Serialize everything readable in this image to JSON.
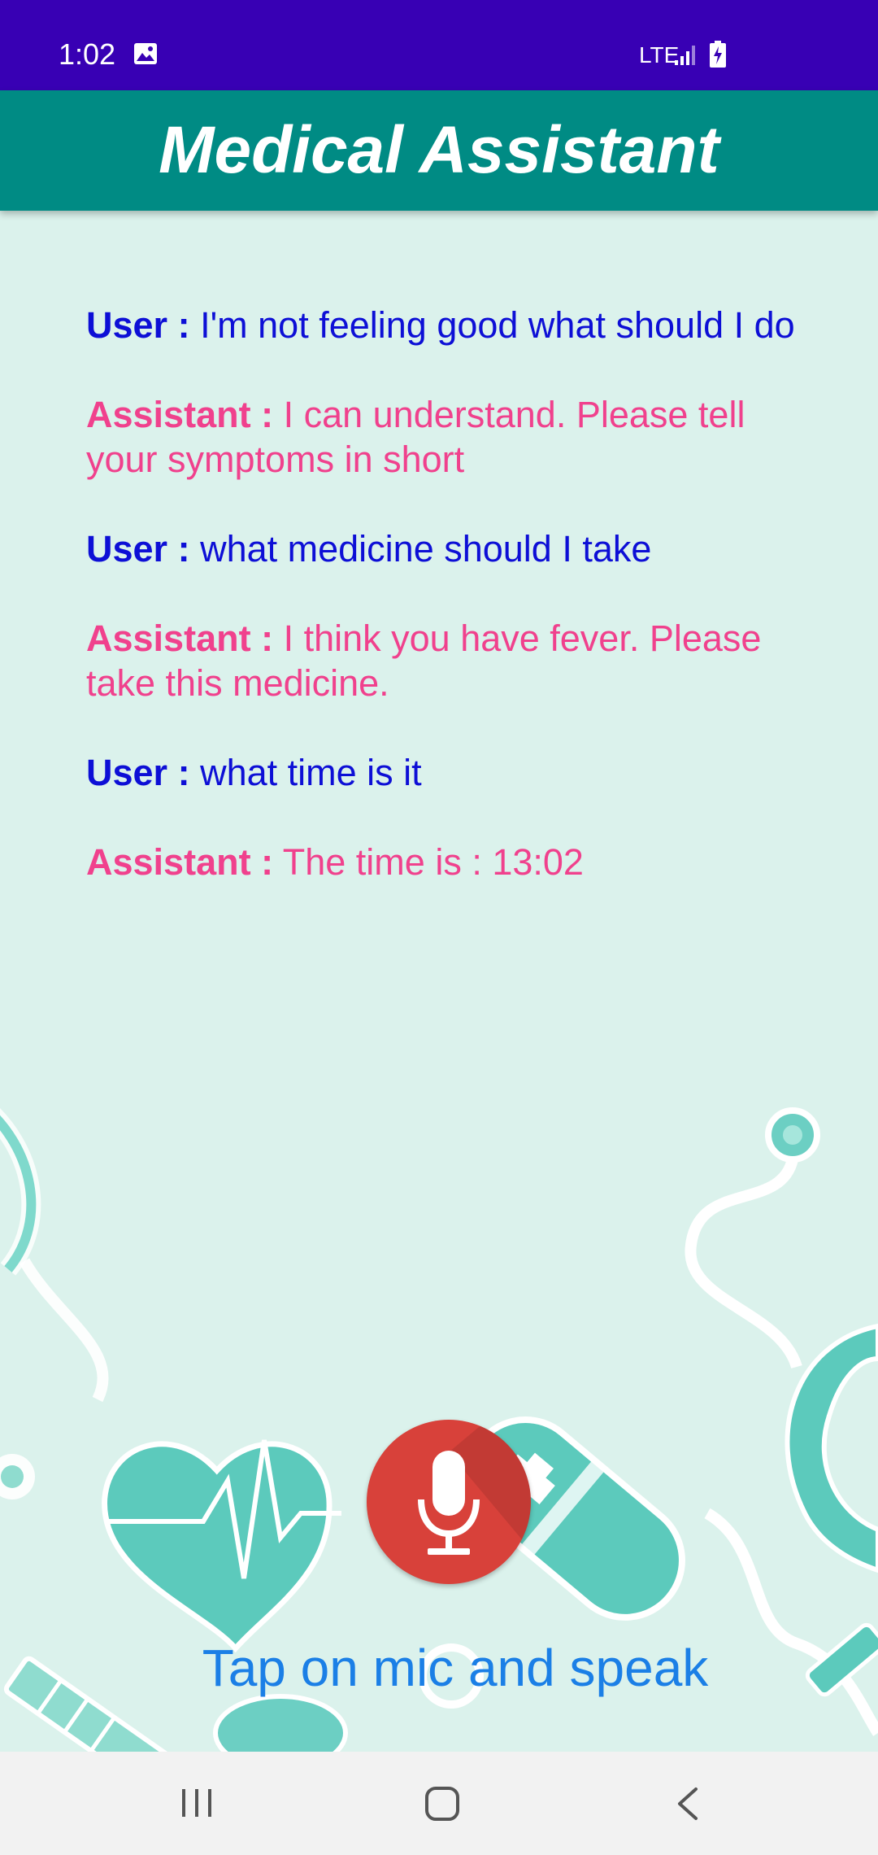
{
  "status_bar": {
    "time": "1:02",
    "network": "LTE",
    "icons": [
      "gallery-icon",
      "signal-icon",
      "battery-charging-icon"
    ]
  },
  "app_bar": {
    "title": "Medical Assistant"
  },
  "chat": {
    "messages": [
      {
        "speaker": "User :",
        "text": "I'm not feeling good what should I do"
      },
      {
        "speaker": "Assistant :",
        "text": "I can understand. Please tell your symptoms in short"
      },
      {
        "speaker": "User :",
        "text": "what medicine should I take"
      },
      {
        "speaker": "Assistant :",
        "text": "I think you have fever. Please take this medicine."
      },
      {
        "speaker": "User :",
        "text": "what time is it"
      },
      {
        "speaker": "Assistant :",
        "text": "The time is : 13:02"
      }
    ]
  },
  "mic": {
    "icon": "microphone-icon"
  },
  "hint": "Tap on mic and speak",
  "nav_bar": {
    "icons": [
      "recents-icon",
      "home-icon",
      "back-icon"
    ]
  },
  "colors": {
    "status_bar": "#3800b4",
    "app_bar": "#008b84",
    "background": "#dbf2ec",
    "user_text": "#0d0fd6",
    "assistant_text": "#f0418d",
    "mic_button": "#d8413a",
    "hint_text": "#1b7fe6"
  }
}
